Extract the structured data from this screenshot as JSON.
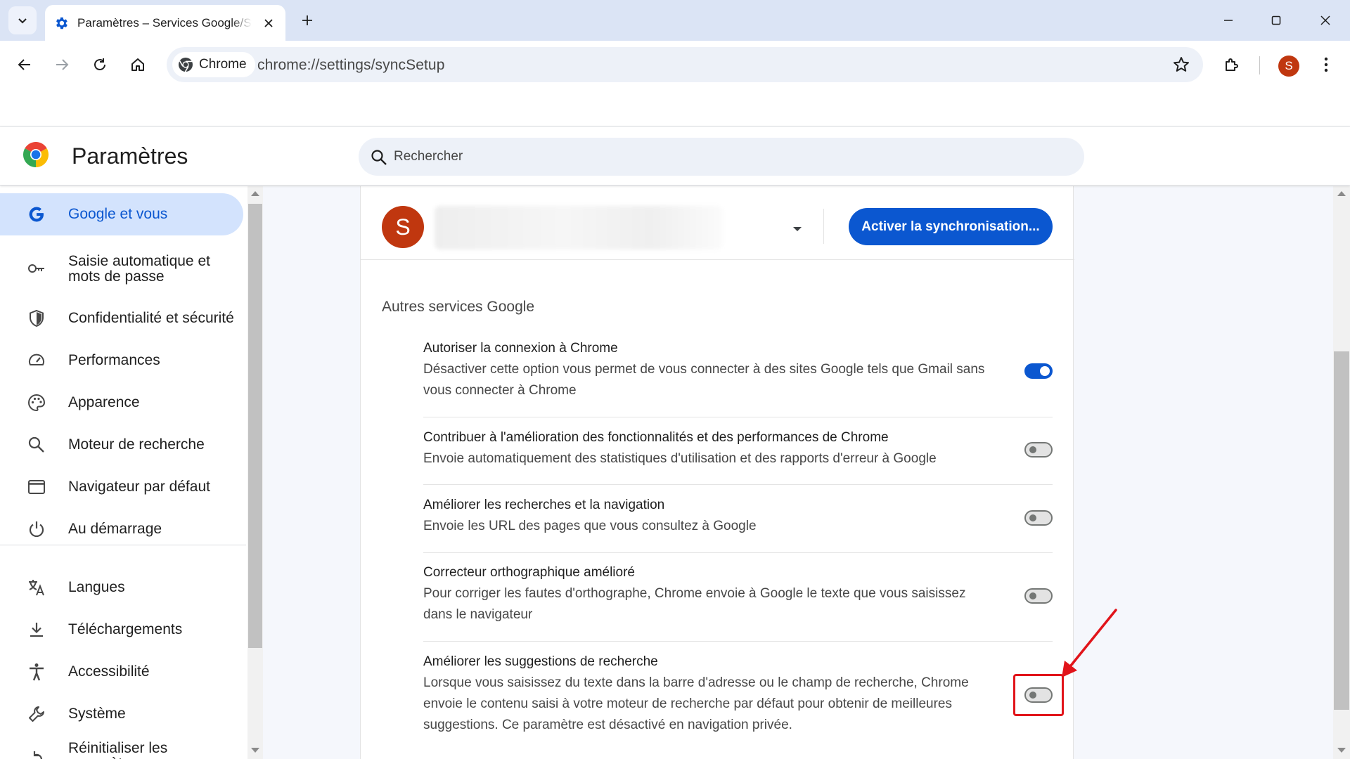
{
  "browser": {
    "tab": {
      "title": "Paramètres – Services Google/Synchronisation"
    },
    "omnibox": {
      "chip_label": "Chrome",
      "url": "chrome://settings/syncSetup"
    },
    "profile_initial": "S",
    "icons": [
      "tab-search-icon",
      "gear-icon",
      "close-icon",
      "plus-icon",
      "minimize-icon",
      "maximize-icon",
      "back-icon",
      "forward-icon",
      "reload-icon",
      "home-icon",
      "chrome-icon",
      "star-icon",
      "extensions-icon",
      "kebab-menu-icon"
    ]
  },
  "settings": {
    "title": "Paramètres",
    "search_placeholder": "Rechercher",
    "nav": [
      {
        "label": "Google et vous",
        "icon": "google-g-icon",
        "active": true
      },
      {
        "label": "Saisie automatique et mots de passe",
        "icon": "key-icon"
      },
      {
        "label": "Confidentialité et sécurité",
        "icon": "shield-icon"
      },
      {
        "label": "Performances",
        "icon": "speedometer-icon"
      },
      {
        "label": "Apparence",
        "icon": "palette-icon"
      },
      {
        "label": "Moteur de recherche",
        "icon": "search-icon"
      },
      {
        "label": "Navigateur par défaut",
        "icon": "browser-window-icon"
      },
      {
        "label": "Au démarrage",
        "icon": "power-icon"
      },
      {
        "label": "Langues",
        "icon": "translate-icon"
      },
      {
        "label": "Téléchargements",
        "icon": "download-icon"
      },
      {
        "label": "Accessibilité",
        "icon": "accessibility-icon"
      },
      {
        "label": "Système",
        "icon": "wrench-icon"
      },
      {
        "label": "Réinitialiser les paramètres",
        "icon": "reset-icon"
      }
    ],
    "profile": {
      "initial": "S",
      "sync_button": "Activer la synchronisation..."
    },
    "section_title": "Autres services Google",
    "rows": [
      {
        "title": "Autoriser la connexion à Chrome",
        "desc": "Désactiver cette option vous permet de vous connecter à des sites Google tels que Gmail sans vous connecter à Chrome",
        "enabled": true
      },
      {
        "title": "Contribuer à l'amélioration des fonctionnalités et des performances de Chrome",
        "desc": "Envoie automatiquement des statistiques d'utilisation et des rapports d'erreur à Google",
        "enabled": false
      },
      {
        "title": "Améliorer les recherches et la navigation",
        "desc": "Envoie les URL des pages que vous consultez à Google",
        "enabled": false
      },
      {
        "title": "Correcteur orthographique amélioré",
        "desc": "Pour corriger les fautes d'orthographe, Chrome envoie à Google le texte que vous saisissez dans le navigateur",
        "enabled": false
      },
      {
        "title": "Améliorer les suggestions de recherche",
        "desc": "Lorsque vous saisissez du texte dans la barre d'adresse ou le champ de recherche, Chrome envoie le contenu saisi à votre moteur de recherche par défaut pour obtenir de meilleures suggestions. Ce paramètre est désactivé en navigation privée.",
        "enabled": false
      }
    ]
  },
  "colors": {
    "accent": "#0b57d0",
    "avatar": "#c0370f",
    "annotation": "#e1141a",
    "tabstrip": "#dbe4f5"
  }
}
